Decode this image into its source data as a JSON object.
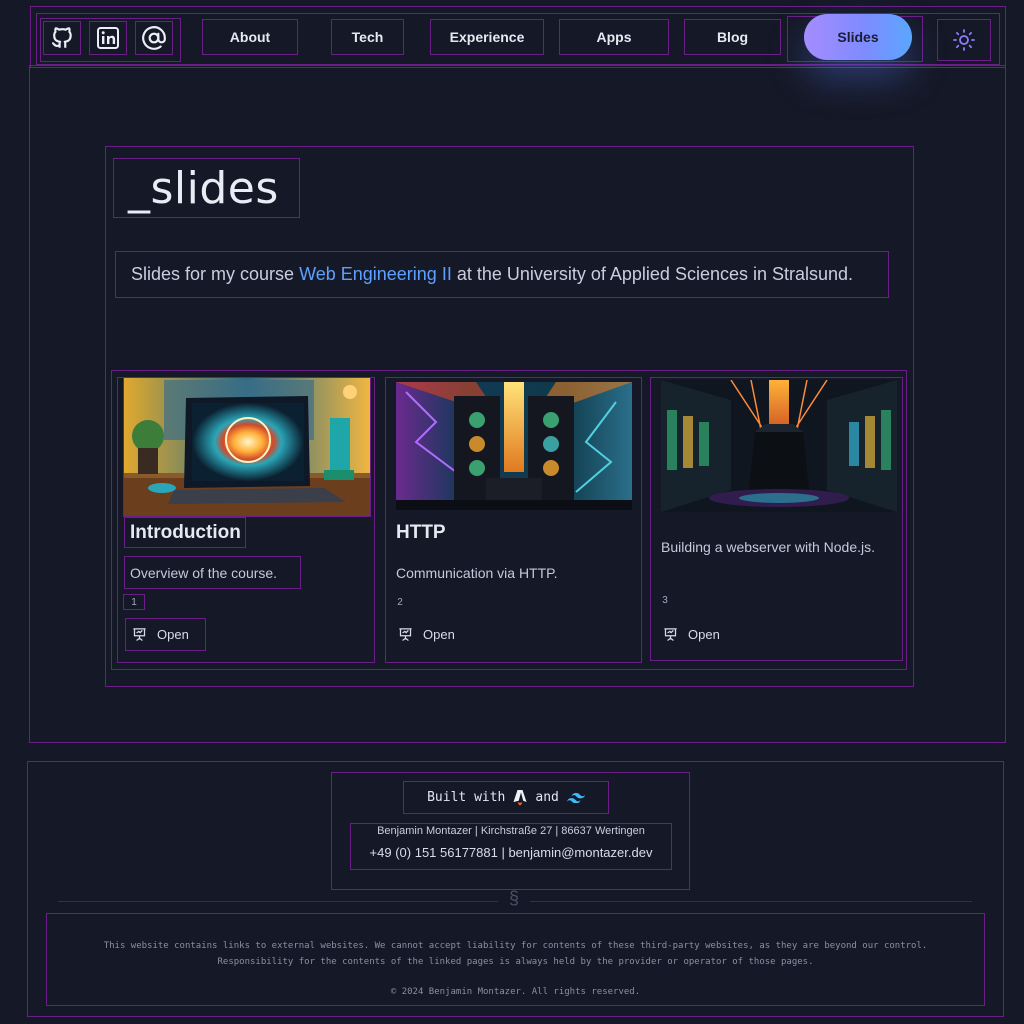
{
  "nav": {
    "social": [
      {
        "icon": "github-icon"
      },
      {
        "icon": "linkedin-icon"
      },
      {
        "icon": "at-sign-icon"
      }
    ],
    "links": [
      {
        "label": "About"
      },
      {
        "label": "Tech"
      },
      {
        "label": "Experience"
      },
      {
        "label": "Apps"
      },
      {
        "label": "Blog"
      }
    ],
    "active_label": "Slides",
    "theme_icon": "sun-icon",
    "active_gradient": [
      "#a58cff",
      "#5aa6ff"
    ]
  },
  "page": {
    "title": "_slides",
    "intro_before": "Slides for my course",
    "intro_link": "Web Engineering II",
    "intro_after": "at the University of Applied Sciences in Stralsund.",
    "link_color": "#5ea0ff"
  },
  "cards": [
    {
      "title": "Introduction",
      "description": "Overview of the course.",
      "number": "1",
      "open_label": "Open",
      "image": "laptop-galaxy-illustration"
    },
    {
      "title": "HTTP",
      "description": "Communication via HTTP.",
      "number": "2",
      "open_label": "Open",
      "image": "server-towers-lightning-illustration"
    },
    {
      "title": "",
      "description": "Building a webserver with Node.js.",
      "number": "3",
      "open_label": "Open",
      "image": "datacenter-cube-illustration"
    }
  ],
  "footer": {
    "built_with": "Built with",
    "and": "and",
    "address": "Benjamin Montazer | Kirchstraße 27 | 86637 Wertingen",
    "contact": "+49 (0) 151 56177881 | benjamin@montazer.dev",
    "section_symbol": "§",
    "disclaimer_line1": "This website contains links to external websites. We cannot accept liability for contents of these third-party websites, as they are beyond our control.",
    "disclaimer_line2": "Responsibility for the contents of the linked pages is always held by the provider or operator of those pages.",
    "copyright": "© 2024 Benjamin Montazer. All rights reserved."
  }
}
